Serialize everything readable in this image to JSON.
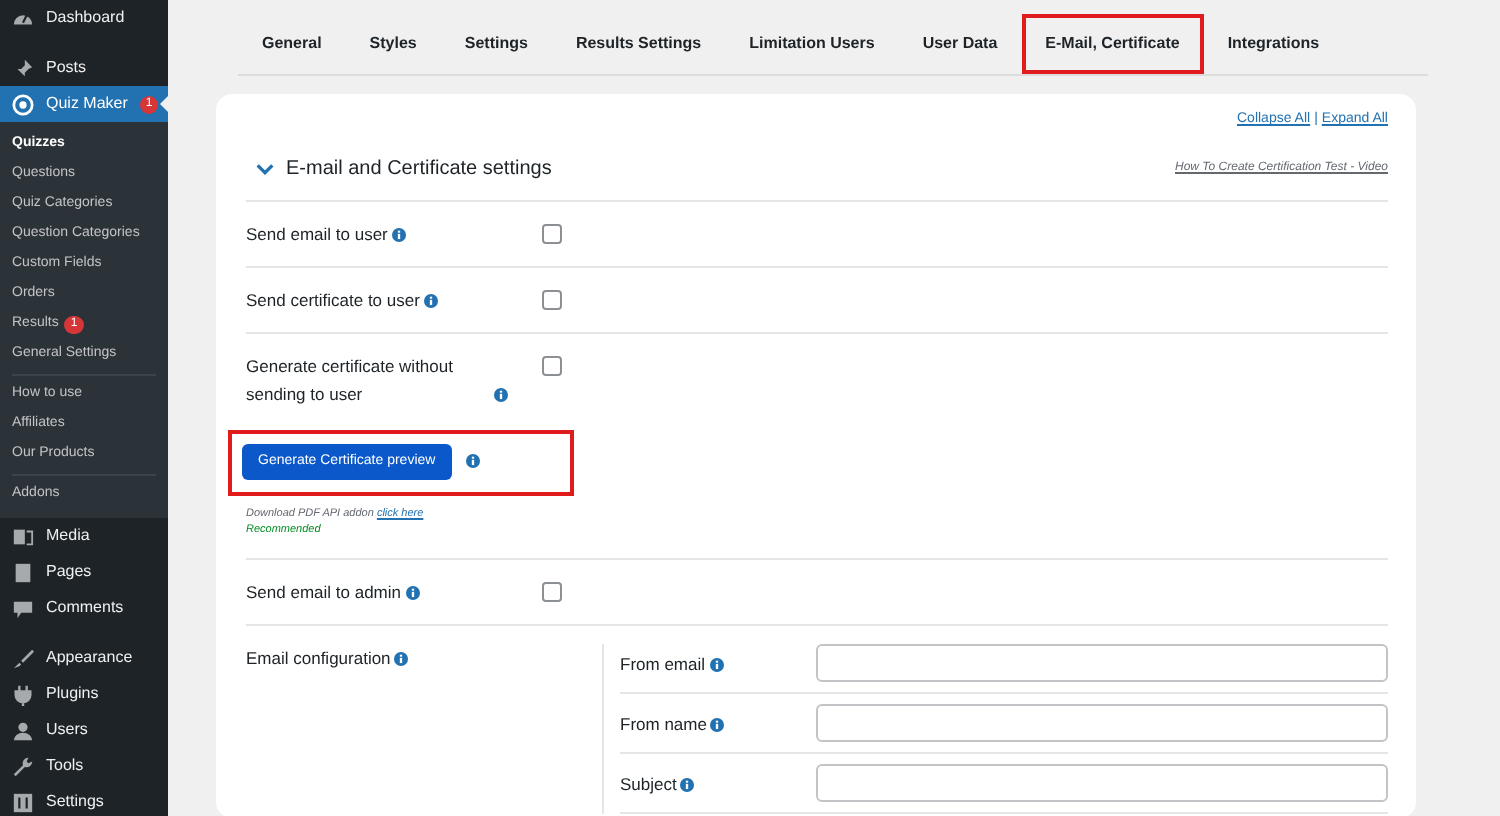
{
  "sidebar": {
    "menu_groups": [
      [
        {
          "label": "Dashboard",
          "selected": false
        }
      ],
      [
        {
          "label": "Posts",
          "selected": false
        },
        {
          "label": "Quiz Maker",
          "selected": true,
          "badge": "1",
          "submenu_groups": [
            [
              {
                "label": "Quizzes",
                "selected": true
              },
              {
                "label": "Questions",
                "selected": false
              },
              {
                "label": "Quiz Categories",
                "selected": false
              },
              {
                "label": "Question Categories",
                "selected": false
              },
              {
                "label": "Custom Fields",
                "selected": false
              },
              {
                "label": "Orders",
                "selected": false
              },
              {
                "label": "Results",
                "selected": false,
                "badge": "1"
              },
              {
                "label": "General Settings",
                "selected": false
              }
            ],
            [
              {
                "label": "How to use",
                "selected": false
              },
              {
                "label": "Affiliates",
                "selected": false
              },
              {
                "label": "Our Products",
                "selected": false
              }
            ],
            [
              {
                "label": "Addons",
                "selected": false
              }
            ]
          ]
        },
        {
          "label": "Media",
          "selected": false
        },
        {
          "label": "Pages",
          "selected": false
        },
        {
          "label": "Comments",
          "selected": false
        }
      ],
      [
        {
          "label": "Appearance",
          "selected": false
        },
        {
          "label": "Plugins",
          "selected": false
        },
        {
          "label": "Users",
          "selected": false
        },
        {
          "label": "Tools",
          "selected": false
        },
        {
          "label": "Settings",
          "selected": false
        }
      ]
    ]
  },
  "tabs": [
    {
      "label": "General",
      "selected": false
    },
    {
      "label": "Styles",
      "selected": false
    },
    {
      "label": "Settings",
      "selected": false
    },
    {
      "label": "Results Settings",
      "selected": false
    },
    {
      "label": "Limitation Users",
      "selected": false
    },
    {
      "label": "User Data",
      "selected": false
    },
    {
      "label": "E-Mail, Certificate",
      "selected": true
    },
    {
      "label": "Integrations",
      "selected": false
    }
  ],
  "card": {
    "links": [
      "Collapse All",
      "Expand All"
    ],
    "link_separator": "|",
    "section": {
      "title": "E-mail and Certificate settings",
      "expanded": true,
      "video_link": "How To Create Certification Test - Video",
      "rows": [
        {
          "kind": "checkbox",
          "label": "Send email to user",
          "checked": false
        },
        {
          "kind": "checkbox",
          "label": "Send certificate to user",
          "checked": false
        },
        {
          "kind": "checkbox",
          "label": "Generate certificate without sending to user",
          "checked": false
        },
        {
          "kind": "button",
          "label": "Generate Certificate preview",
          "highlighted": true,
          "note": "Download PDF API addon",
          "note_link": "click here",
          "recommended": "Recommended"
        },
        {
          "kind": "checkbox",
          "label": "Send email to admin",
          "checked": false
        },
        {
          "kind": "config",
          "label": "Email configuration",
          "fields": [
            {
              "label": "From email"
            },
            {
              "label": "From name"
            },
            {
              "label": "Subject"
            }
          ]
        }
      ]
    }
  }
}
